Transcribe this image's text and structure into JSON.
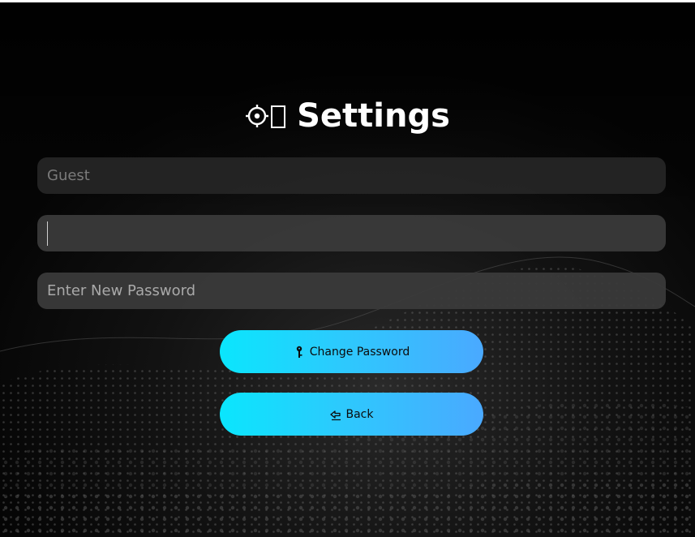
{
  "header": {
    "title": "Settings",
    "title_icons": [
      "gear-icon",
      "missing-glyph-box"
    ]
  },
  "fields": {
    "username_placeholder": "Guest",
    "current_password_value": "",
    "new_password_placeholder": "Enter New Password"
  },
  "buttons": {
    "change_password_label": "Change Password",
    "change_password_icon": "key-icon",
    "back_label": "Back",
    "back_icon": "back-arrow-icon"
  },
  "colors": {
    "background": "#050505",
    "button_gradient_start": "#0ae6fd",
    "button_gradient_end": "#4aa9ff",
    "field_background": "#3a3a3a",
    "title_text": "#ffffff"
  }
}
